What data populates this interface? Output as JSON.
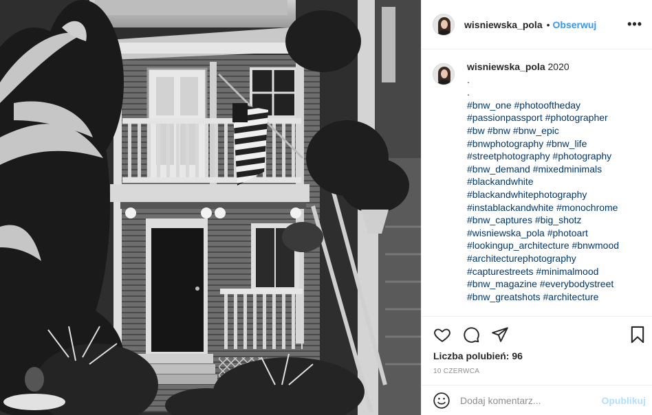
{
  "post": {
    "username": "wisniewska_pola",
    "follow_dot": "•",
    "follow_label": "Obserwuj",
    "more_label": "•••"
  },
  "caption": {
    "username": "wisniewska_pola",
    "text": "2020",
    "dots": [
      ".",
      "."
    ],
    "hashtag_lines": [
      "#bnw_one #photooftheday",
      "#passionpassport #photographer",
      "#bw #bnw #bnw_epic",
      "#bnwphotography #bnw_life",
      "#streetphotography #photography",
      "#bnw_demand #mixedminimals",
      "#blackandwhite",
      "#blackandwhitephotography",
      "#instablackandwhite #monochrome",
      "#bnw_captures #big_shotz",
      "#wisniewska_pola #photoart",
      "#lookingup_architecture #bnwmood",
      "#architecturephotography",
      "#capturestreets #minimalmood",
      "#bnw_magazine #everybodystreet",
      "#bnw_greatshots #architecture"
    ]
  },
  "actions": {
    "like_icon": "heart-icon",
    "comment_icon": "comment-icon",
    "share_icon": "share-icon",
    "save_icon": "bookmark-icon",
    "likes_text": "Liczba polubień: 96",
    "date": "10 czerwca"
  },
  "comment_box": {
    "emoji_icon": "smiley-icon",
    "placeholder": "Dodaj komentarz...",
    "publish_label": "Opublikuj"
  },
  "colors": {
    "accent": "#3897f0",
    "hashtag": "#00376b",
    "publish_disabled": "#b2dffc",
    "muted": "#8e8e8e"
  }
}
